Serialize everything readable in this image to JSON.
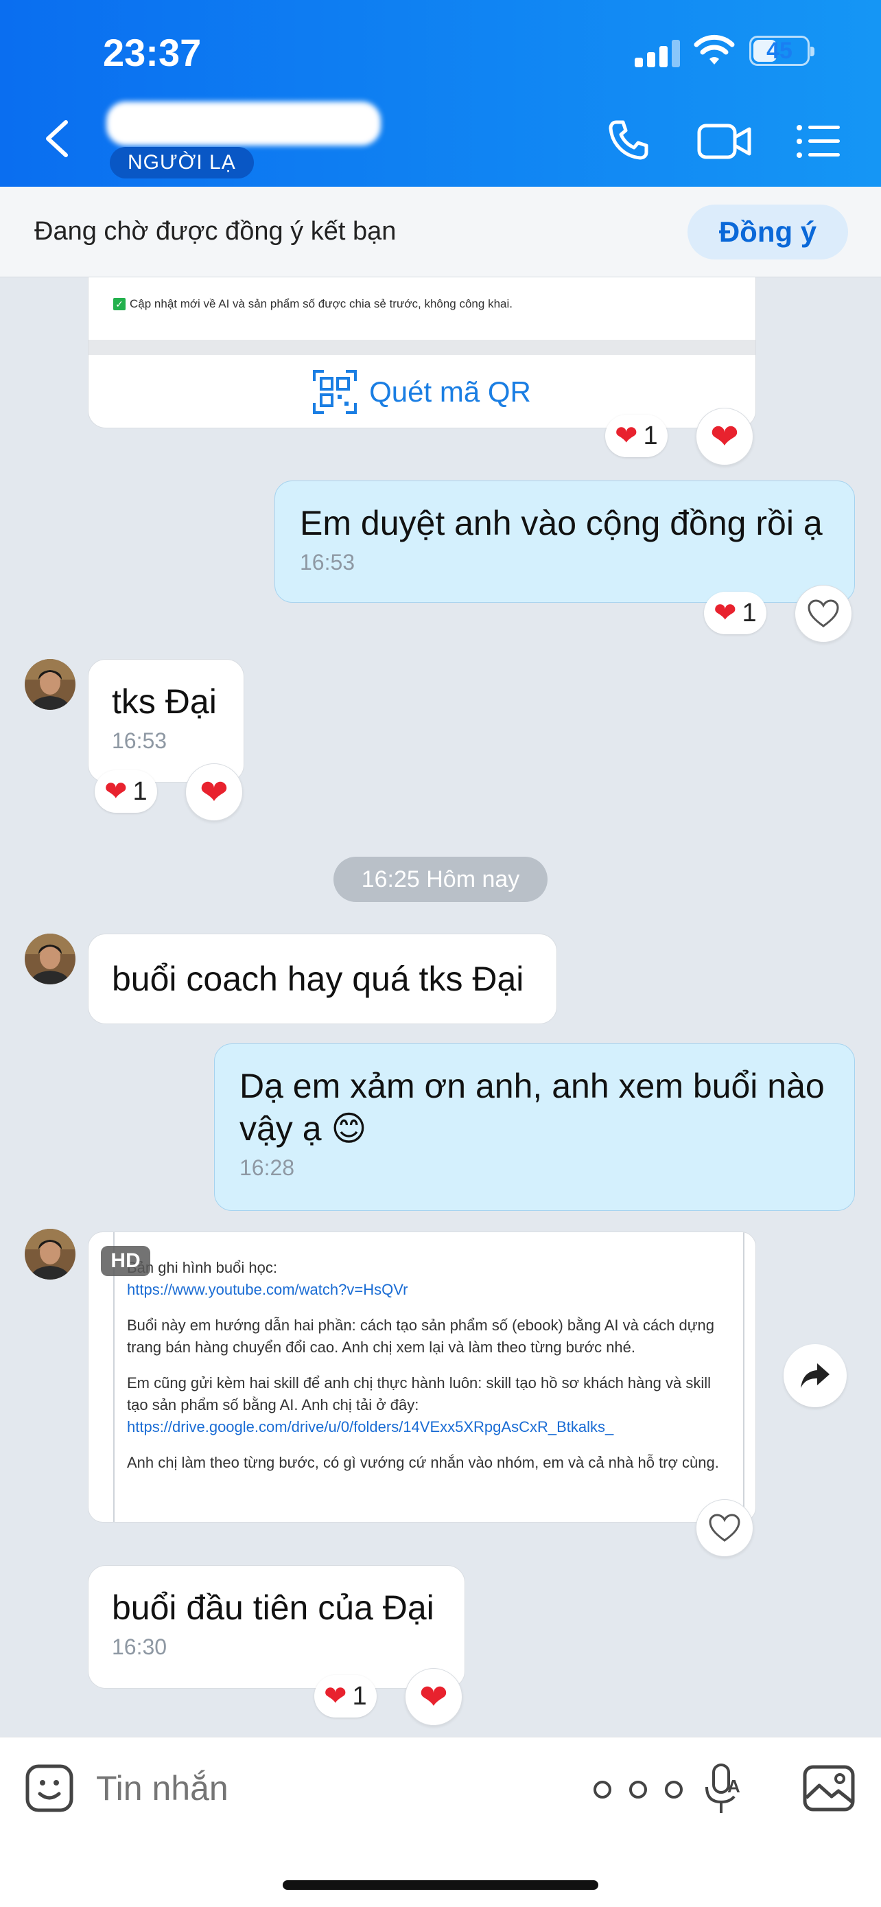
{
  "status_bar": {
    "time": "23:37",
    "battery": "45",
    "battery_level": 0.45
  },
  "header": {
    "stranger_label": "NGƯỜI LẠ"
  },
  "banner": {
    "text": "Đang chờ được đồng ý kết bạn",
    "accept_label": "Đồng ý"
  },
  "qr_card": {
    "note": "Cập nhật mới về AI và sản phẩm số được chia sẻ trước, không công khai.",
    "scan_label": "Quét mã QR",
    "reaction_count": "1"
  },
  "messages": [
    {
      "text": "Em duyệt anh vào cộng đồng rồi ạ",
      "time": "16:53",
      "reaction_count": "1"
    },
    {
      "text": "tks Đại",
      "time": "16:53",
      "reaction_count": "1"
    },
    {
      "text": "buổi coach hay quá tks Đại"
    },
    {
      "text": "Dạ em xảm ơn anh, anh xem buổi nào vậy ạ 😊",
      "time": "16:28"
    },
    {
      "text": "buổi đầu tiên của Đại",
      "time": "16:30",
      "reaction_count": "1"
    }
  ],
  "time_divider": "16:25 Hôm nay",
  "image_message": {
    "hd_badge": "HD",
    "line1": "Bản ghi hình buổi học:",
    "link1": "https://www.youtube.com/watch?v=HsQVr",
    "para2": "Buổi này em hướng dẫn hai phần: cách tạo sản phẩm số (ebook) bằng AI và cách dựng trang bán hàng chuyển đổi cao. Anh chị xem lại và làm theo từng bước nhé.",
    "para3": "Em cũng gửi kèm hai skill để anh chị thực hành luôn: skill tạo hồ sơ khách hàng và skill tạo sản phẩm số bằng AI. Anh chị tải ở đây:",
    "link2": "https://drive.google.com/drive/u/0/folders/14VExx5XRpgAsCxR_Btkalks_",
    "para4": "Anh chị làm theo từng bước, có gì vướng cứ nhắn vào nhóm, em và cả nhà hỗ trợ cùng."
  },
  "input": {
    "placeholder": "Tin nhắn"
  },
  "colors": {
    "header": "#1183f2",
    "outgoing_bubble": "#d4f0fd",
    "heart": "#e8222e",
    "link": "#1a6cd4"
  }
}
